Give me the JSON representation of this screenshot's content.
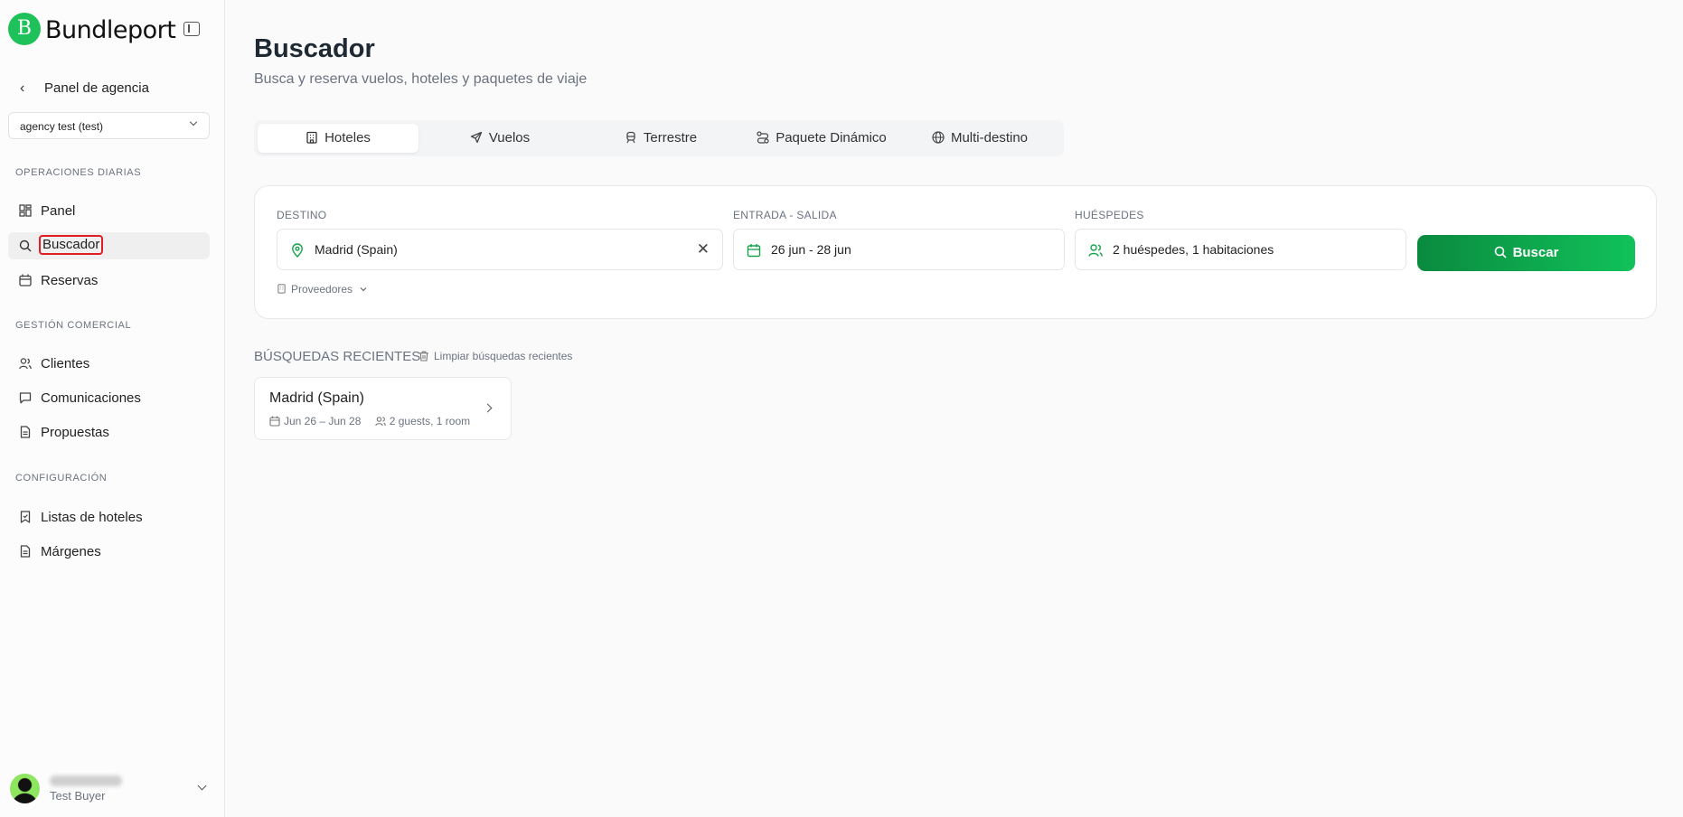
{
  "brand": {
    "logo_text": "Bundleport",
    "logo_mark": "B",
    "accent": "#1fc15a"
  },
  "sidebar": {
    "back_label": "Panel de agencia",
    "agency_select": "agency test (test)",
    "sections": [
      {
        "title": "OPERACIONES DIARIAS",
        "items": [
          {
            "label": "Panel",
            "icon": "dashboard-icon"
          },
          {
            "label": "Buscador",
            "icon": "search-icon"
          },
          {
            "label": "Reservas",
            "icon": "calendar-icon"
          }
        ]
      },
      {
        "title": "GESTIÓN COMERCIAL",
        "items": [
          {
            "label": "Clientes",
            "icon": "users-icon"
          },
          {
            "label": "Comunicaciones",
            "icon": "chat-icon"
          },
          {
            "label": "Propuestas",
            "icon": "document-icon"
          }
        ]
      },
      {
        "title": "CONFIGURACIÓN",
        "items": [
          {
            "label": "Listas de hoteles",
            "icon": "bookmark-icon"
          },
          {
            "label": "Márgenes",
            "icon": "document-icon"
          }
        ]
      }
    ],
    "user": {
      "role": "Test Buyer"
    }
  },
  "main": {
    "title": "Buscador",
    "subtitle": "Busca y reserva vuelos, hoteles y paquetes de viaje",
    "tabs": [
      {
        "label": "Hoteles",
        "icon": "hotel-icon"
      },
      {
        "label": "Vuelos",
        "icon": "plane-icon"
      },
      {
        "label": "Terrestre",
        "icon": "train-icon"
      },
      {
        "label": "Paquete Dinámico",
        "icon": "route-icon"
      },
      {
        "label": "Multi-destino",
        "icon": "globe-icon"
      }
    ],
    "search": {
      "destination_label": "DESTINO",
      "destination_value": "Madrid (Spain)",
      "dates_label": "ENTRADA - SALIDA",
      "dates_value": "26 jun - 28 jun",
      "guests_label": "HUÉSPEDES",
      "guests_value": "2 huéspedes, 1 habitaciones",
      "search_button": "Buscar",
      "providers_label": "Proveedores"
    },
    "recent": {
      "title": "BÚSQUEDAS RECIENTES",
      "clear_label": "Limpiar búsquedas recientes",
      "items": [
        {
          "destination": "Madrid (Spain)",
          "dates": "Jun 26 – Jun 28",
          "guests": "2 guests, 1 room"
        }
      ]
    }
  }
}
